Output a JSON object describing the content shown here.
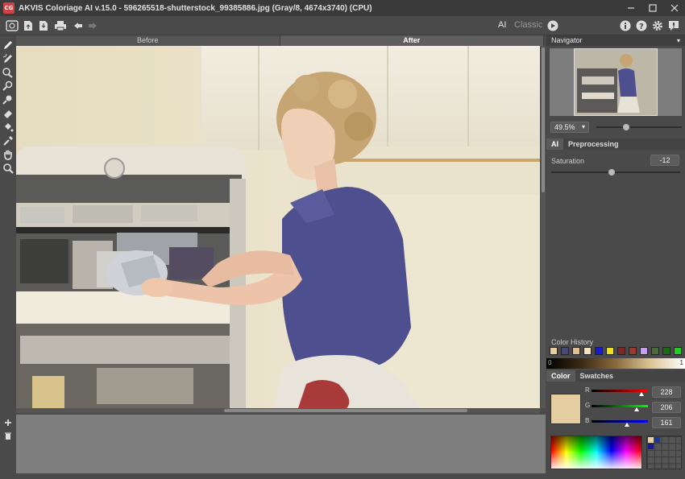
{
  "window": {
    "logo_text": "CG",
    "title": "AKVIS Coloriage AI v.15.0 - 596265518-shutterstock_99385886.jpg (Gray/8, 4674x3740) (CPU)",
    "controls": [
      "minimize-icon",
      "maximize-icon",
      "close-icon"
    ]
  },
  "toolbar": {
    "icons": [
      "open-image-icon",
      "open-file-icon",
      "save-file-icon",
      "print-icon",
      "undo-icon",
      "redo-icon"
    ],
    "mode_ai": "AI",
    "mode_classic": "Classic",
    "right_icons": [
      "run-icon",
      "info-icon",
      "help-icon",
      "settings-icon",
      "feedback-icon"
    ]
  },
  "tools": [
    "color-pencil-icon",
    "magic-pencil-icon",
    "color-brush-icon",
    "keep-color-icon",
    "eraser-icon",
    "bucket-icon",
    "eyedropper-icon",
    "hand-icon",
    "zoom-icon"
  ],
  "view_tabs": {
    "before": "Before",
    "after": "After",
    "active": "After"
  },
  "navigator": {
    "title": "Navigator",
    "zoom": "49.5%"
  },
  "settings_tabs": {
    "ai": "AI",
    "preprocessing": "Preprocessing",
    "active": "AI"
  },
  "saturation": {
    "label": "Saturation",
    "value": "-12",
    "level": 0.47
  },
  "color_history": {
    "title": "Color History",
    "swatches": [
      "#e8cfa0",
      "#4a4a7a",
      "#e0c090",
      "#f5e0c0",
      "#1a1ad0",
      "#f0e020",
      "#7a2828",
      "#9a3a30",
      "#c8a0f0",
      "#4a6a3a",
      "#1a6a1a",
      "#20d020"
    ],
    "gradient_start": "0",
    "gradient_end": "1"
  },
  "color_tabs": {
    "color": "Color",
    "swatches": "Swatches",
    "active": "Color"
  },
  "color": {
    "current": "#e4cea1",
    "r_label": "R",
    "r": "228",
    "g_label": "G",
    "g": "206",
    "b_label": "B",
    "b": "161"
  },
  "bottom_left_icons": [
    "add-icon",
    "delete-icon"
  ]
}
